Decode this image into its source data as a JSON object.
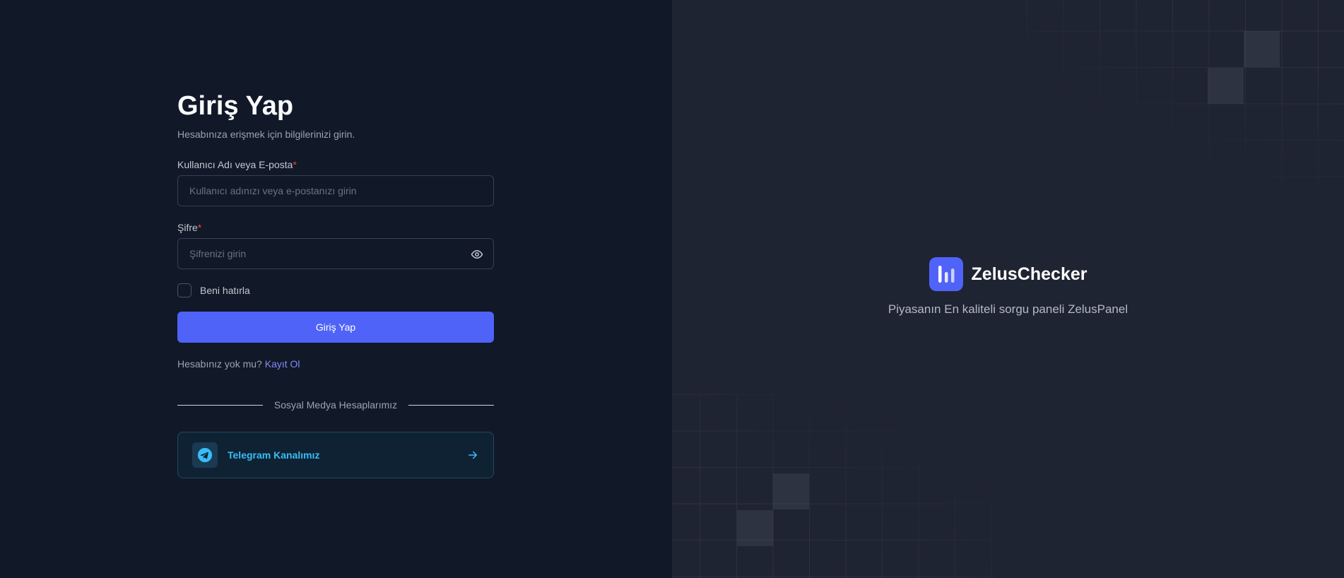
{
  "login": {
    "title": "Giriş Yap",
    "subtitle": "Hesabınıza erişmek için bilgilerinizi girin.",
    "username_label": "Kullanıcı Adı veya E-posta",
    "required_mark": "*",
    "username_placeholder": "Kullanıcı adınızı veya e-postanızı girin",
    "password_label": "Şifre",
    "password_placeholder": "Şifrenizi girin",
    "remember_label": "Beni hatırla",
    "submit_label": "Giriş Yap",
    "no_account_text": "Hesabınız yok mu?",
    "register_link": "Kayıt Ol",
    "social_heading": "Sosyal Medya Hesaplarımız",
    "telegram_label": "Telegram Kanalımız"
  },
  "brand": {
    "name": "ZelusChecker",
    "tagline": "Piyasanın En kaliteli sorgu paneli ZelusPanel"
  },
  "icons": {
    "password_toggle": "eye-icon",
    "telegram": "telegram-icon",
    "arrow": "arrow-right-icon",
    "logo": "bar-chart-logo-icon"
  },
  "colors": {
    "primary": "#4f63f9",
    "left_bg": "#111827",
    "right_bg": "#1f2433",
    "telegram_accent": "#38bdf8",
    "required": "#ef4444",
    "link": "#818cf8"
  }
}
